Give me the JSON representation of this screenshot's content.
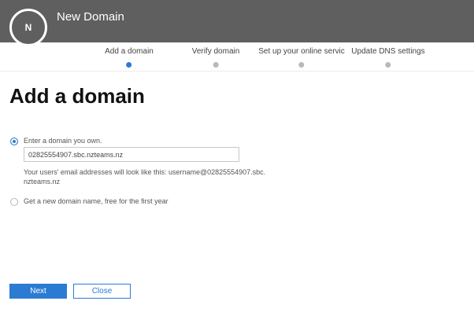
{
  "header": {
    "avatar_initial": "N",
    "title": "New Domain"
  },
  "steps": [
    {
      "label": "Add a domain",
      "active": true
    },
    {
      "label": "Verify domain",
      "active": false
    },
    {
      "label": "Set up your online servic",
      "active": false
    },
    {
      "label": "Update DNS settings",
      "active": false
    }
  ],
  "page": {
    "heading": "Add a domain"
  },
  "options": {
    "own_domain": {
      "label": "Enter a domain you own.",
      "value": "02825554907.sbc.nzteams.nz",
      "hint": "Your users' email addresses will look like this: username@02825554907.sbc.nzteams.nz",
      "selected": true
    },
    "new_domain": {
      "label": "Get a new domain name, free for the first year",
      "selected": false
    }
  },
  "buttons": {
    "next": "Next",
    "close": "Close"
  },
  "colors": {
    "header_bg": "#5f5f5f",
    "accent": "#2b7bd3"
  }
}
